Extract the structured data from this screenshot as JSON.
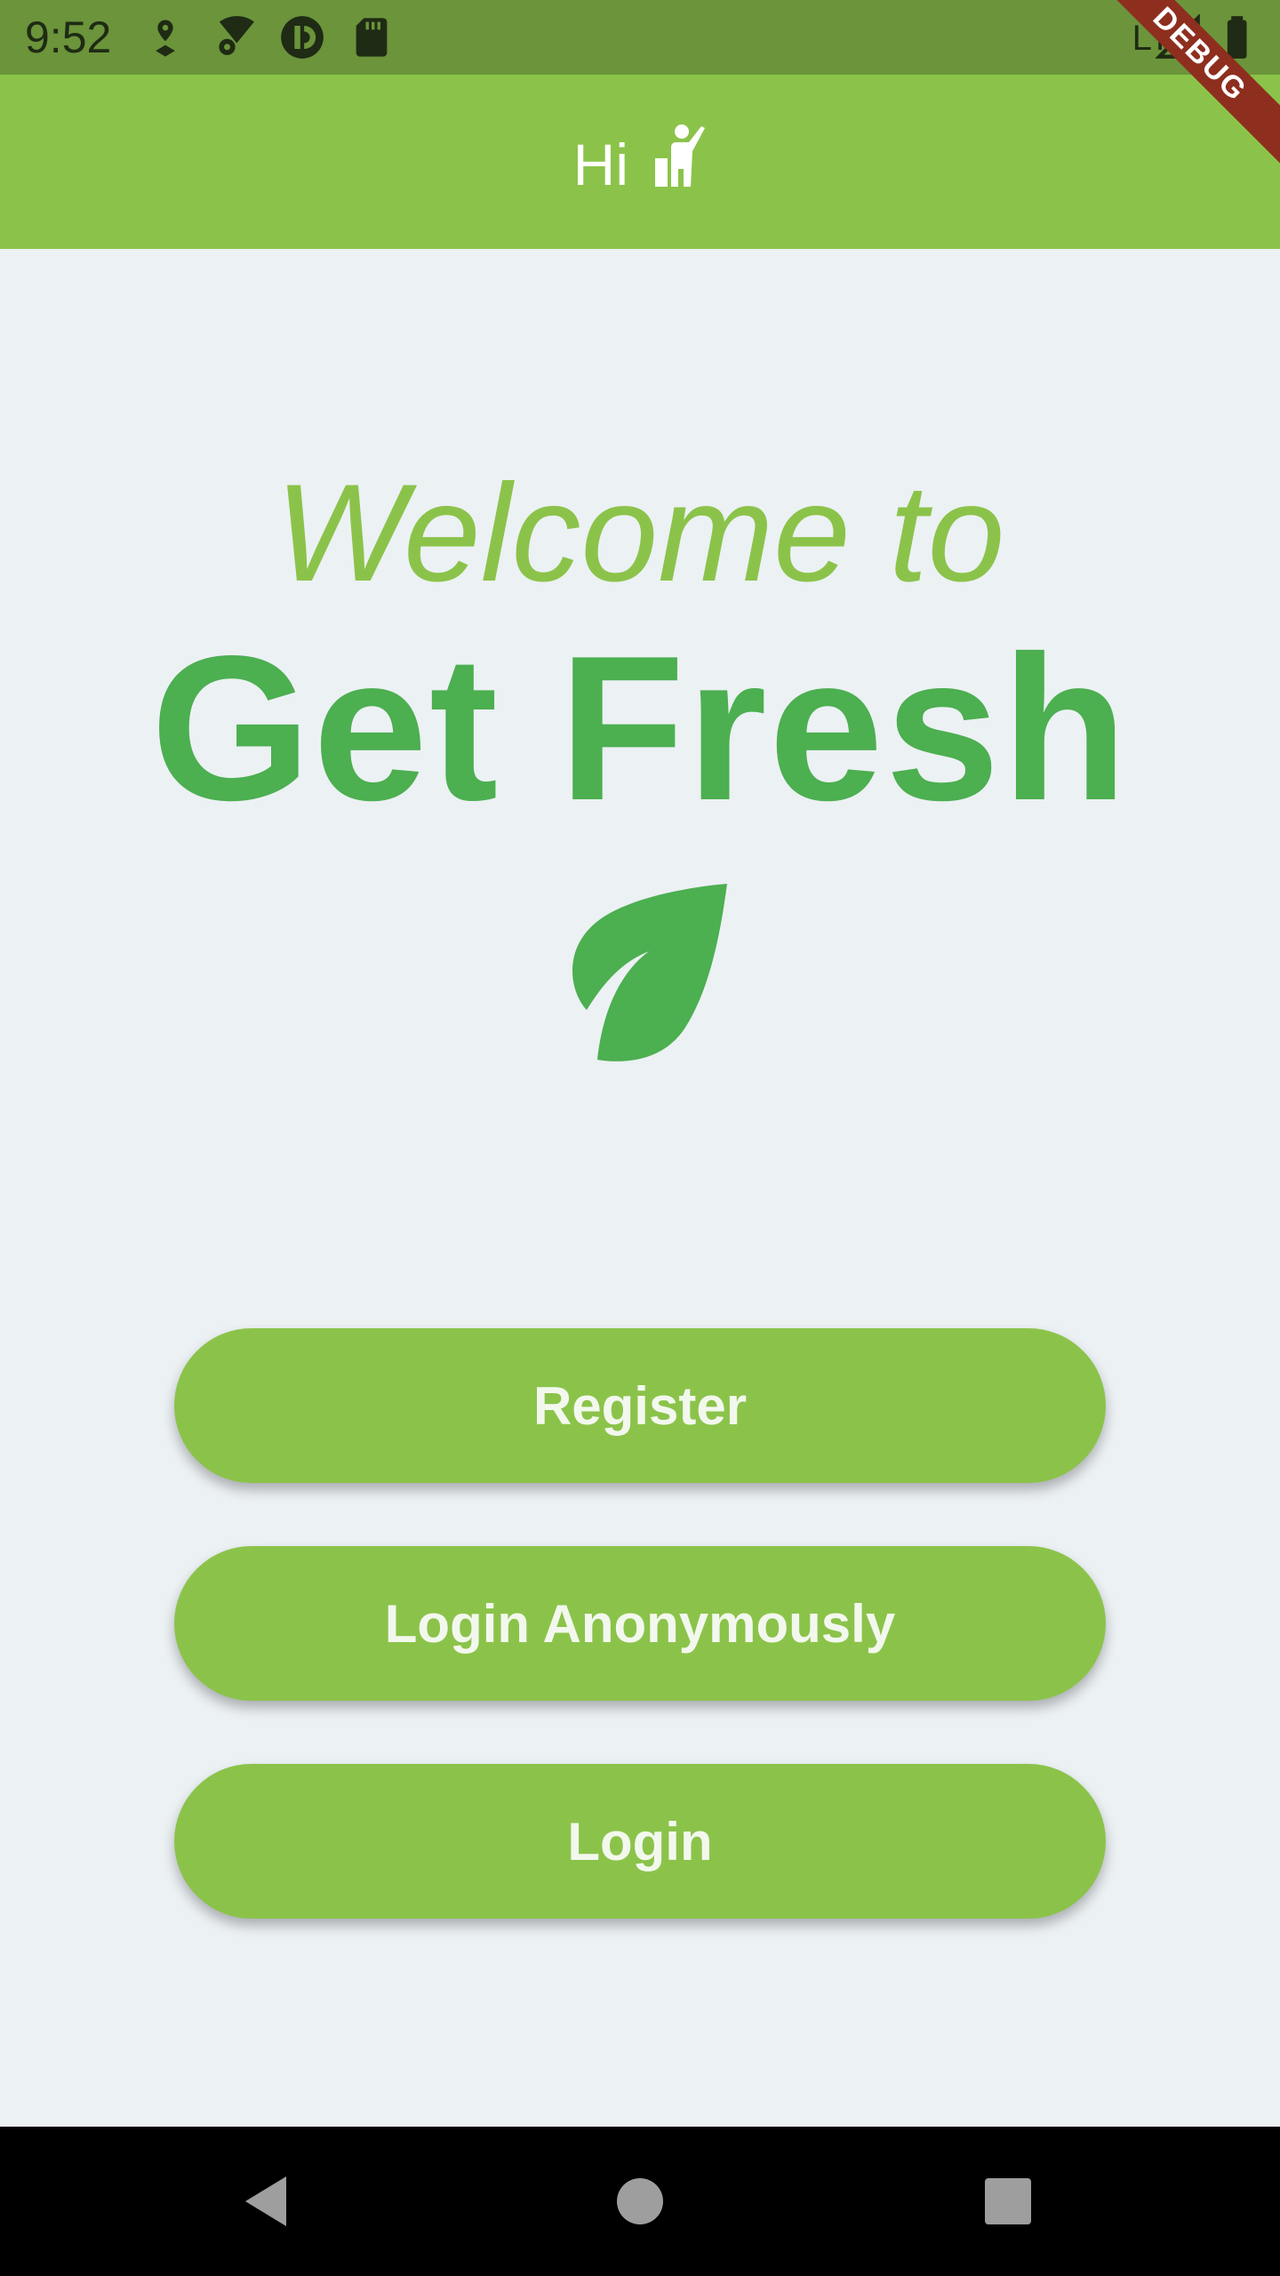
{
  "status_bar": {
    "time": "9:52",
    "network": "LTE",
    "icons": [
      "location-pin-icon",
      "wifi-settings-icon",
      "pocket-casts-icon",
      "sd-card-icon",
      "signal-icon",
      "battery-icon"
    ]
  },
  "app_bar": {
    "title": "Hi",
    "title_icon": "person-waving-icon"
  },
  "debug_banner": "DEBUG",
  "hero": {
    "welcome": "Welcome to",
    "brand": "Get Fresh",
    "logo_icon": "leaf-icon"
  },
  "buttons": {
    "register": "Register",
    "login_anonymously": "Login Anonymously",
    "login": "Login"
  },
  "nav": {
    "icons": [
      "back-icon",
      "home-icon",
      "recent-apps-icon"
    ]
  },
  "colors": {
    "status_bar": "#6B943B",
    "app_bar": "#8BC34A",
    "background": "#ECF1F4",
    "brand_green": "#4CAF50",
    "light_green": "#8BC34A"
  }
}
